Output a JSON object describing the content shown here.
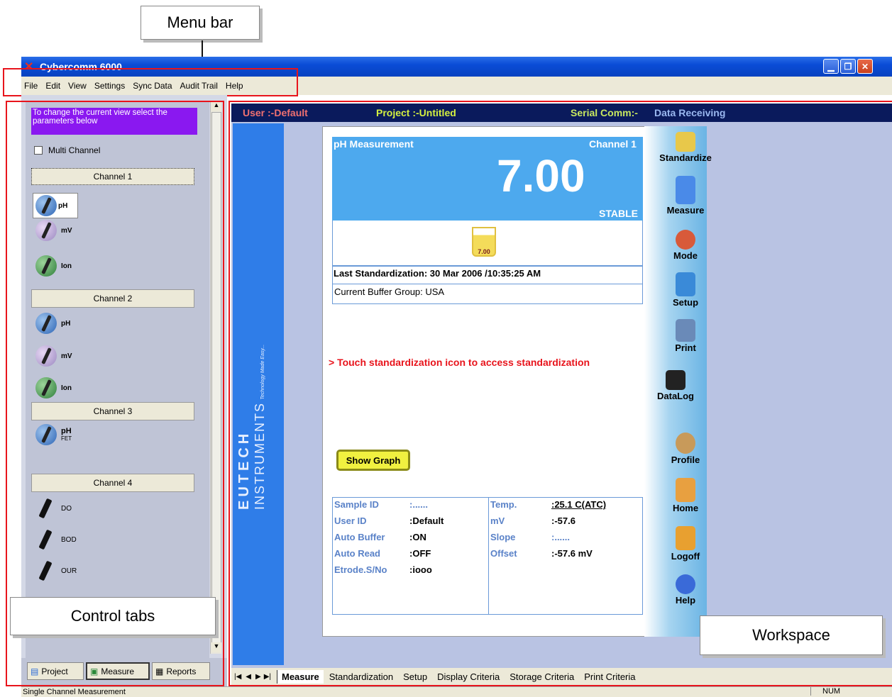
{
  "callouts": {
    "menu_bar": "Menu bar",
    "control_tabs": "Control tabs",
    "workspace": "Workspace"
  },
  "window": {
    "title": "Cybercomm 6000"
  },
  "menu": [
    "File",
    "Edit",
    "View",
    "Settings",
    "Sync Data",
    "Audit Trail",
    "Help"
  ],
  "left_panel": {
    "hint": "To change the current view select the parameters below",
    "multi_channel_label": "Multi Channel",
    "channels": {
      "ch1": {
        "label": "Channel 1",
        "items": [
          "pH",
          "mV",
          "Ion"
        ]
      },
      "ch2": {
        "label": "Channel 2",
        "items": [
          "pH",
          "mV",
          "Ion"
        ]
      },
      "ch3": {
        "label": "Channel 3",
        "items": [
          "pH",
          "FET"
        ]
      },
      "ch4": {
        "label": "Channel 4",
        "items": [
          "DO",
          "BOD",
          "OUR"
        ]
      }
    },
    "tabs": [
      "Project",
      "Measure",
      "Reports"
    ]
  },
  "header": {
    "user": "User :-Default",
    "project": "Project :-Untitled",
    "serial_label": "Serial Comm:-",
    "serial_value": "Data Receiving"
  },
  "brand": {
    "big": "EUTECH",
    "sub": "INSTRUMENTS",
    "tagline": "Technology Made Easy..."
  },
  "measurement": {
    "title": "pH Measurement",
    "channel": "Channel 1",
    "value": "7.00",
    "status": "STABLE",
    "beaker_label": "7.00",
    "last_std": "Last Standardization: 30 Mar 2006 /10:35:25 AM",
    "buffer_group": "Current Buffer Group: USA",
    "hint": "> Touch standardization icon to access standardization",
    "show_graph": "Show Graph"
  },
  "info_left": [
    {
      "label": "Sample ID",
      "value": ":......"
    },
    {
      "label": "User ID",
      "value": ":Default"
    },
    {
      "label": "Auto Buffer",
      "value": ":ON"
    },
    {
      "label": "Auto Read",
      "value": ":OFF"
    },
    {
      "label": "Etrode.S/No",
      "value": ":iooo"
    }
  ],
  "info_right": [
    {
      "label": "Temp.",
      "value": ":25.1 C(ATC)"
    },
    {
      "label": "mV",
      "value": ":-57.6"
    },
    {
      "label": "Slope",
      "value": ":......"
    },
    {
      "label": "Offset",
      "value": ":-57.6 mV"
    }
  ],
  "tools": [
    "Standardize",
    "Measure",
    "Mode",
    "Setup",
    "Print",
    "DataLog",
    "Profile",
    "Home",
    "Logoff",
    "Help"
  ],
  "tool_colors": [
    "#e8c84a",
    "#4a8ae8",
    "#d85a3a",
    "#3a8ad8",
    "#6a8ab8",
    "#222222",
    "#c89a5a",
    "#e8a040",
    "#e8a030",
    "#3a6ad8"
  ],
  "bottom_tabs": [
    "Measure",
    "Standardization",
    "Setup",
    "Display Criteria",
    "Storage Criteria",
    "Print Criteria"
  ],
  "status": {
    "text": "Single Channel Measurement",
    "num": "NUM"
  }
}
